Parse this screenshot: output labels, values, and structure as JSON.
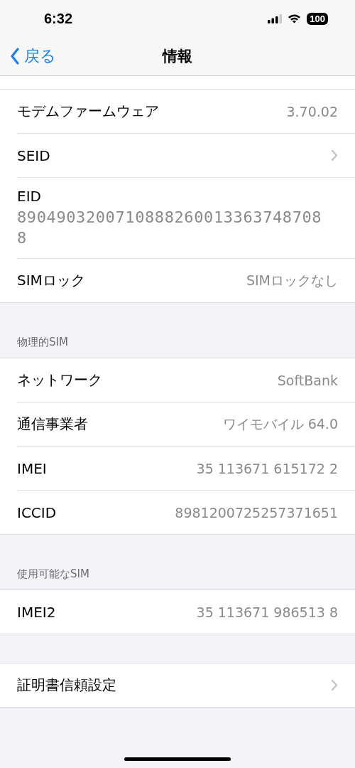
{
  "status_bar": {
    "time": "6:32",
    "battery": "100"
  },
  "nav": {
    "back": "戻る",
    "title": "情報"
  },
  "sections": [
    {
      "rows": [
        {
          "kind": "value",
          "label": "モデムファームウェア",
          "value": "3.70.02"
        },
        {
          "kind": "chevron",
          "label": "SEID"
        },
        {
          "kind": "stacked",
          "label": "EID",
          "value": "89049032007108882600133637487088"
        },
        {
          "kind": "value",
          "label": "SIMロック",
          "value": "SIMロックなし"
        }
      ]
    },
    {
      "header": "物理的SIM",
      "rows": [
        {
          "kind": "value",
          "label": "ネットワーク",
          "value": "SoftBank"
        },
        {
          "kind": "value",
          "label": "通信事業者",
          "value": "ワイモバイル 64.0"
        },
        {
          "kind": "value",
          "label": "IMEI",
          "value": "35 113671 615172 2"
        },
        {
          "kind": "value",
          "label": "ICCID",
          "value": "8981200725257371651"
        }
      ]
    },
    {
      "header": "使用可能なSIM",
      "rows": [
        {
          "kind": "value",
          "label": "IMEI2",
          "value": "35 113671 986513 8"
        }
      ]
    },
    {
      "rows": [
        {
          "kind": "chevron",
          "label": "証明書信頼設定"
        }
      ]
    }
  ]
}
